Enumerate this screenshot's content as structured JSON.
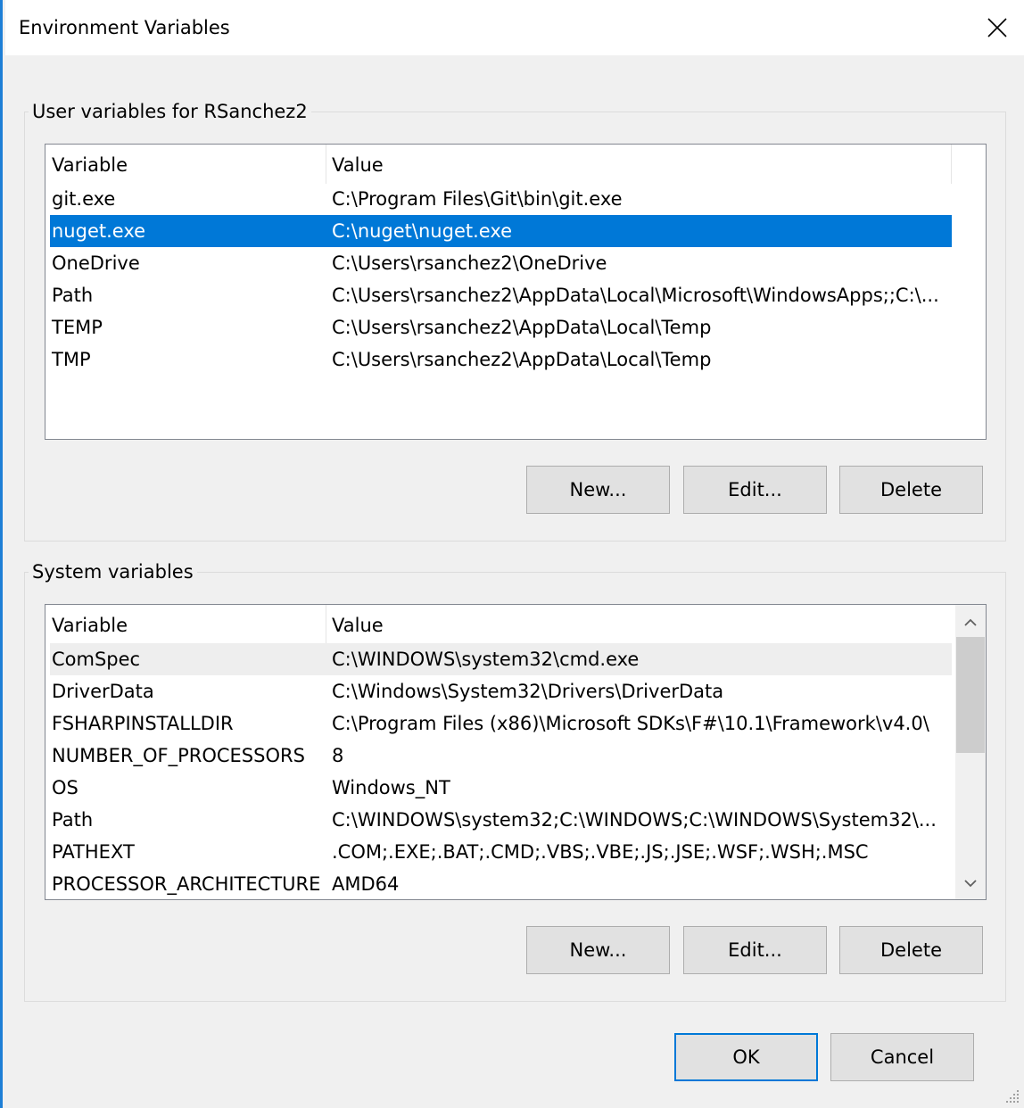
{
  "window": {
    "title": "Environment Variables",
    "close_icon": "close-icon"
  },
  "user_group": {
    "label": "User variables for RSanchez2",
    "columns": [
      "Variable",
      "Value"
    ],
    "rows": [
      {
        "variable": "git.exe",
        "value": "C:\\Program Files\\Git\\bin\\git.exe"
      },
      {
        "variable": "nuget.exe",
        "value": "C:\\nuget\\nuget.exe"
      },
      {
        "variable": "OneDrive",
        "value": "C:\\Users\\rsanchez2\\OneDrive"
      },
      {
        "variable": "Path",
        "value": "C:\\Users\\rsanchez2\\AppData\\Local\\Microsoft\\WindowsApps;;C:\\..."
      },
      {
        "variable": "TEMP",
        "value": "C:\\Users\\rsanchez2\\AppData\\Local\\Temp"
      },
      {
        "variable": "TMP",
        "value": "C:\\Users\\rsanchez2\\AppData\\Local\\Temp"
      }
    ],
    "selected_index": 1,
    "buttons": {
      "new": "New...",
      "edit": "Edit...",
      "delete": "Delete"
    }
  },
  "system_group": {
    "label": "System variables",
    "columns": [
      "Variable",
      "Value"
    ],
    "rows": [
      {
        "variable": "ComSpec",
        "value": "C:\\WINDOWS\\system32\\cmd.exe"
      },
      {
        "variable": "DriverData",
        "value": "C:\\Windows\\System32\\Drivers\\DriverData"
      },
      {
        "variable": "FSHARPINSTALLDIR",
        "value": "C:\\Program Files (x86)\\Microsoft SDKs\\F#\\10.1\\Framework\\v4.0\\"
      },
      {
        "variable": "NUMBER_OF_PROCESSORS",
        "value": "8"
      },
      {
        "variable": "OS",
        "value": "Windows_NT"
      },
      {
        "variable": "Path",
        "value": "C:\\WINDOWS\\system32;C:\\WINDOWS;C:\\WINDOWS\\System32\\..."
      },
      {
        "variable": "PATHEXT",
        "value": ".COM;.EXE;.BAT;.CMD;.VBS;.VBE;.JS;.JSE;.WSF;.WSH;.MSC"
      },
      {
        "variable": "PROCESSOR_ARCHITECTURE",
        "value": "AMD64"
      }
    ],
    "hover_index": 0,
    "buttons": {
      "new": "New...",
      "edit": "Edit...",
      "delete": "Delete"
    }
  },
  "footer": {
    "ok": "OK",
    "cancel": "Cancel"
  },
  "colors": {
    "selection": "#0078d7",
    "accent_border": "#1e7fd6"
  }
}
